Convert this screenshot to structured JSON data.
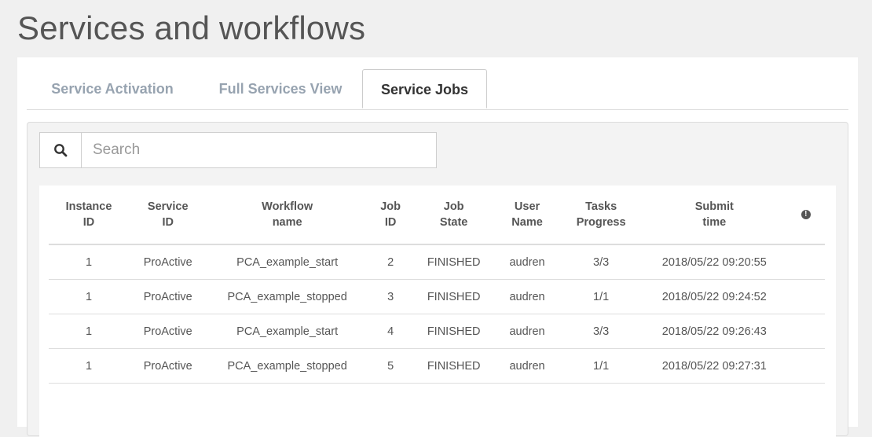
{
  "page": {
    "title": "Services and workflows"
  },
  "tabs": [
    {
      "label": "Service Activation",
      "active": false
    },
    {
      "label": "Full Services View",
      "active": false
    },
    {
      "label": "Service Jobs",
      "active": true
    }
  ],
  "search": {
    "placeholder": "Search",
    "value": "",
    "icon": "search-icon"
  },
  "table": {
    "headers": [
      {
        "line1": "Instance",
        "line2": "ID"
      },
      {
        "line1": "Service",
        "line2": "ID"
      },
      {
        "line1": "Workflow",
        "line2": "name"
      },
      {
        "line1": "Job",
        "line2": "ID"
      },
      {
        "line1": "Job",
        "line2": "State"
      },
      {
        "line1": "User",
        "line2": "Name"
      },
      {
        "line1": "Tasks",
        "line2": "Progress"
      },
      {
        "line1": "Submit",
        "line2": "time"
      }
    ],
    "info_icon": "exclamation-circle-icon",
    "rows": [
      [
        "1",
        "ProActive",
        "PCA_example_start",
        "2",
        "FINISHED",
        "audren",
        "3/3",
        "2018/05/22 09:20:55"
      ],
      [
        "1",
        "ProActive",
        "PCA_example_stopped",
        "3",
        "FINISHED",
        "audren",
        "1/1",
        "2018/05/22 09:24:52"
      ],
      [
        "1",
        "ProActive",
        "PCA_example_start",
        "4",
        "FINISHED",
        "audren",
        "3/3",
        "2018/05/22 09:26:43"
      ],
      [
        "1",
        "ProActive",
        "PCA_example_stopped",
        "5",
        "FINISHED",
        "audren",
        "1/1",
        "2018/05/22 09:27:31"
      ]
    ]
  },
  "colors": {
    "inactive_tab": "#97a3b0",
    "active_tab": "#333333",
    "background": "#f0f0f0"
  }
}
